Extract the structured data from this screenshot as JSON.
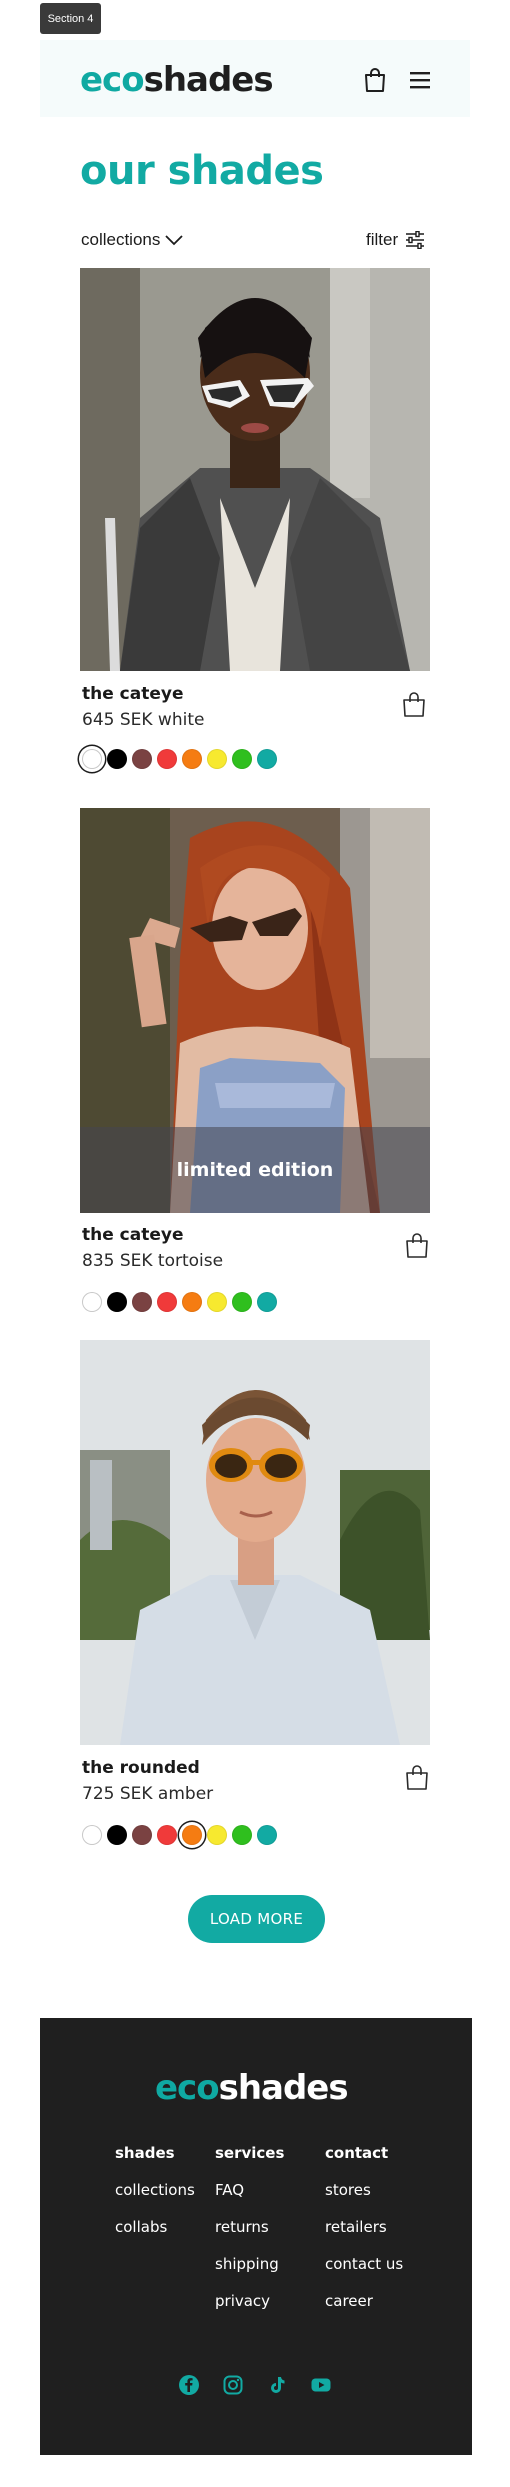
{
  "section_badge": "Section 4",
  "header": {
    "logo_eco": "eco",
    "logo_shades": "shades"
  },
  "page_title": "our shades",
  "toolbar": {
    "collections_label": "collections",
    "filter_label": "filter"
  },
  "products": [
    {
      "name": "the cateye",
      "price": "645 SEK white",
      "banner": "",
      "selected_swatch": 0
    },
    {
      "name": "the cateye",
      "price": "835 SEK tortoise",
      "banner": "limited edition",
      "selected_swatch": -1
    },
    {
      "name": "the rounded",
      "price": "725 SEK amber",
      "banner": "",
      "selected_swatch": 4
    }
  ],
  "swatch_colors": [
    "#ffffff",
    "#000000",
    "#7a4242",
    "#f03a3a",
    "#f57c12",
    "#f7e92f",
    "#2fbf1e",
    "#12aaa3"
  ],
  "load_more_label": "LOAD MORE",
  "footer": {
    "logo_eco": "eco",
    "logo_shades": "shades",
    "columns": [
      {
        "title": "shades",
        "links": [
          "collections",
          "collabs"
        ]
      },
      {
        "title": "services",
        "links": [
          "FAQ",
          "returns",
          "shipping",
          "privacy"
        ]
      },
      {
        "title": "contact",
        "links": [
          "stores",
          "retailers",
          "contact us",
          "career"
        ]
      }
    ],
    "socials": [
      "facebook-icon",
      "instagram-icon",
      "tiktok-icon",
      "youtube-icon"
    ],
    "accent_color": "#12aaa3"
  },
  "colors": {
    "brand_teal": "#12aaa3",
    "footer_bg": "#1f1f1f",
    "header_bg": "#f5fbfb"
  }
}
